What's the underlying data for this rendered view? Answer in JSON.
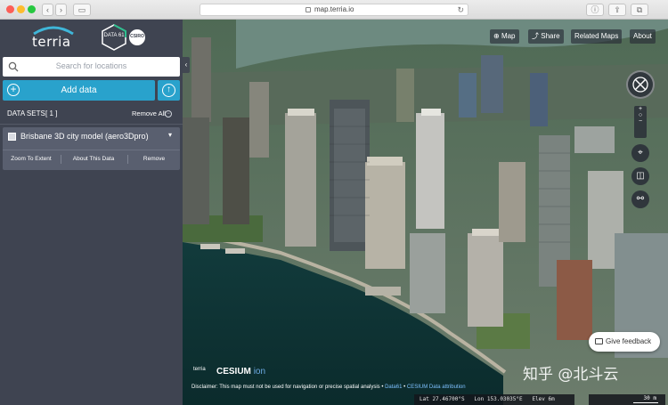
{
  "browser": {
    "url": "map.terria.io",
    "colors": {
      "close": "#fc5f57",
      "minimize": "#fdbc2e",
      "zoom": "#27c840"
    }
  },
  "sidebar": {
    "logo_text": "terria",
    "partner_logo_text": "DATA 61",
    "partner_logo_sub": "CSIRO",
    "search": {
      "placeholder": "Search for locations"
    },
    "add_data_label": "Add data",
    "datasets": {
      "title": "DATA SETS",
      "count": "[ 1 ]",
      "remove_all_label": "Remove All",
      "items": [
        {
          "name": "Brisbane 3D city model (aero3Dpro)",
          "actions": [
            "Zoom To Extent",
            "About This Data",
            "Remove"
          ]
        }
      ]
    },
    "colors": {
      "panel": "#3f4451",
      "accent": "#29a2cc",
      "item": "#595f6f"
    }
  },
  "map": {
    "menu": [
      "Map",
      "Share",
      "Related Maps",
      "About"
    ],
    "feedback_label": "Give feedback",
    "logos": {
      "terria": "terria",
      "cesium": "CESIUM",
      "cesium_suffix": "ion"
    },
    "disclaimer": "Disclaimer: This map must not be used for navigation or precise spatial analysis",
    "attribution_links": [
      "Data61",
      "CESIUM",
      "Data attribution"
    ],
    "coords": {
      "lat": "Lat 27.46700°S",
      "lon": "Lon 153.03035°E",
      "elev": "Elev 6m"
    },
    "scale_label": "30 m",
    "tools": [
      "compass-icon",
      "zoom-in-icon",
      "zoom-out-icon",
      "location-icon",
      "split-icon",
      "measure-icon"
    ]
  },
  "watermark": "知乎 @北斗云"
}
